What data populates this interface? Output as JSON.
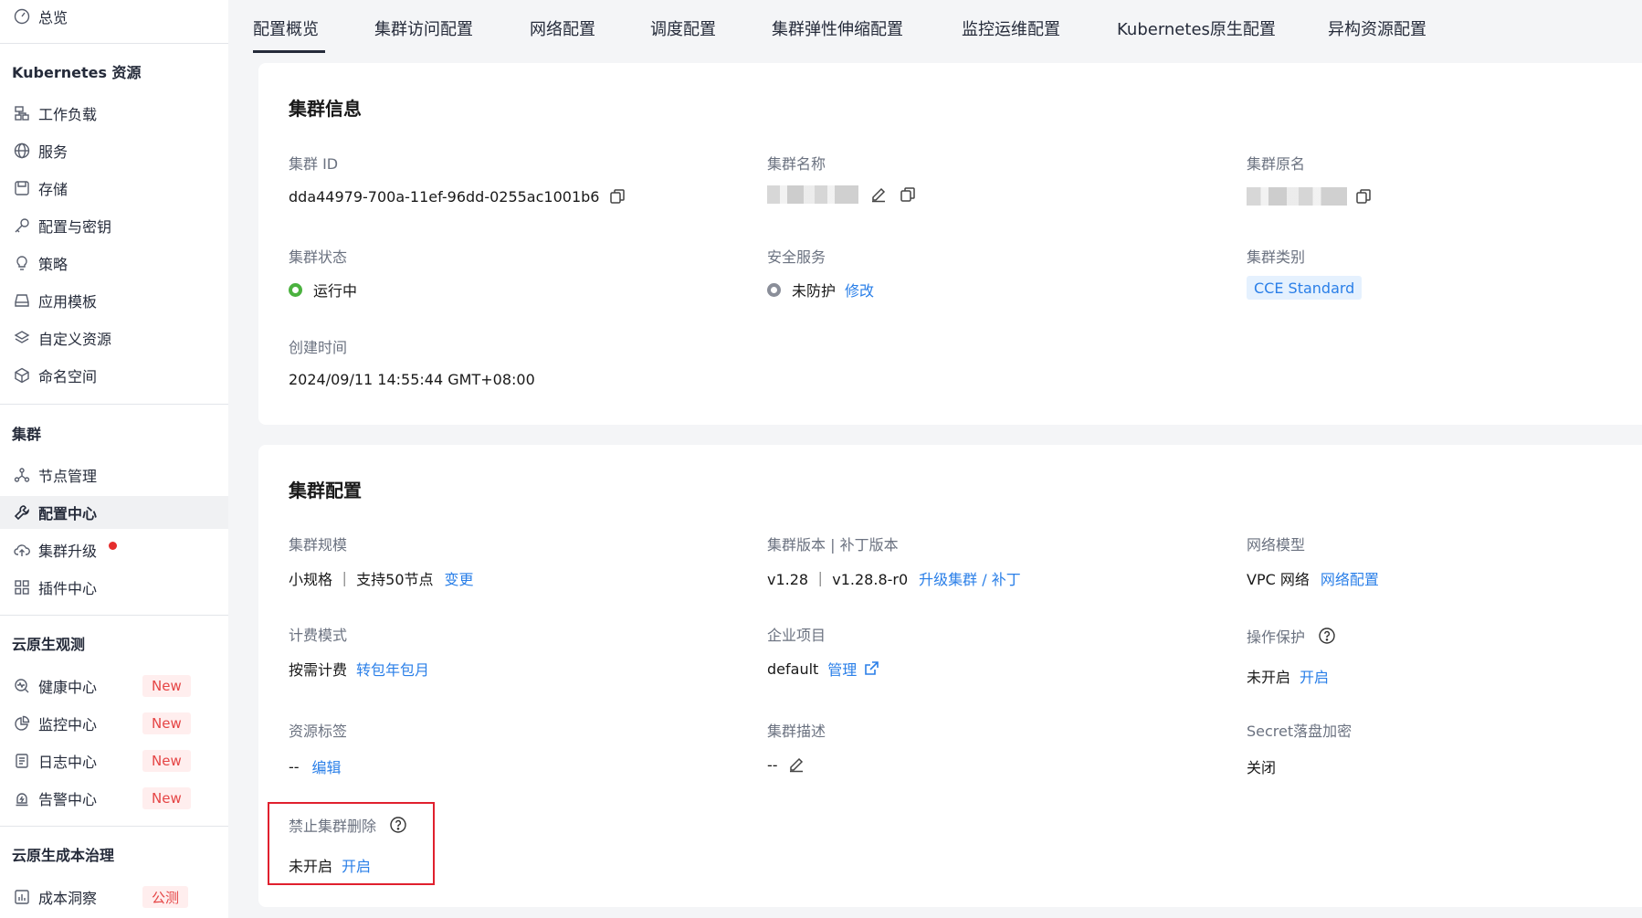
{
  "sidebar": {
    "top_item": "总览",
    "section_k8s": "Kubernetes 资源",
    "k8s_items": [
      "工作负载",
      "服务",
      "存储",
      "配置与密钥",
      "策略",
      "应用模板",
      "自定义资源",
      "命名空间"
    ],
    "section_cluster": "集群",
    "cluster_items": [
      "节点管理",
      "配置中心",
      "集群升级",
      "插件中心"
    ],
    "section_observe": "云原生观测",
    "observe_items": [
      "健康中心",
      "监控中心",
      "日志中心",
      "告警中心"
    ],
    "badge_new": "New",
    "section_cost": "云原生成本治理",
    "cost_items": [
      "成本洞察"
    ],
    "badge_public": "公测"
  },
  "tabs": [
    "配置概览",
    "集群访问配置",
    "网络配置",
    "调度配置",
    "集群弹性伸缩配置",
    "监控运维配置",
    "Kubernetes原生配置",
    "异构资源配置"
  ],
  "cluster_info": {
    "title": "集群信息",
    "id_label": "集群 ID",
    "id_value": "dda44979-700a-11ef-96dd-0255ac1001b6",
    "name_label": "集群名称",
    "origin_label": "集群原名",
    "status_label": "集群状态",
    "status_value": "运行中",
    "security_label": "安全服务",
    "security_value": "未防护",
    "security_link": "修改",
    "type_label": "集群类别",
    "type_value": "CCE Standard",
    "created_label": "创建时间",
    "created_value": "2024/09/11 14:55:44 GMT+08:00"
  },
  "cluster_config": {
    "title": "集群配置",
    "scale_label": "集群规模",
    "scale_value": "小规格 ｜ 支持50节点",
    "scale_link": "变更",
    "version_label": "集群版本 | 补丁版本",
    "version_value": "v1.28 ｜ v1.28.8-r0",
    "version_link": "升级集群 / 补丁",
    "network_label": "网络模型",
    "network_value": "VPC 网络",
    "network_link": "网络配置",
    "billing_label": "计费模式",
    "billing_value": "按需计费",
    "billing_link": "转包年包月",
    "project_label": "企业项目",
    "project_value": "default",
    "project_link": "管理",
    "protect_label": "操作保护",
    "protect_value": "未开启",
    "protect_link": "开启",
    "tags_label": "资源标签",
    "tags_value": "--",
    "tags_link": "编辑",
    "desc_label": "集群描述",
    "desc_value": "--",
    "secret_label": "Secret落盘加密",
    "secret_value": "关闭",
    "delete_label": "禁止集群删除",
    "delete_value": "未开启",
    "delete_link": "开启"
  },
  "colors": {
    "accent": "#2a7fe8",
    "running": "#4bb23f",
    "danger": "#e0202e",
    "badge_bg": "#ffeeee"
  }
}
